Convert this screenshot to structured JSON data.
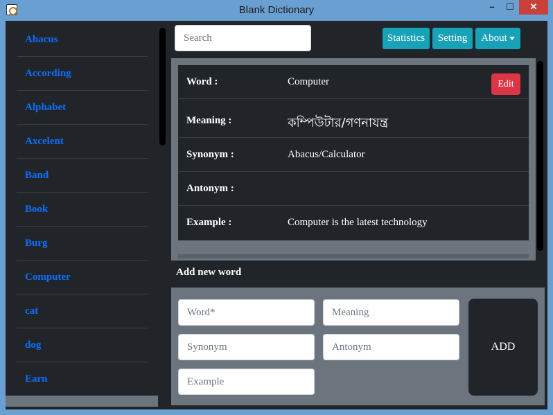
{
  "window": {
    "title": "Blank Dictionary",
    "minimize": "–",
    "maximize": "☐",
    "close": "✕"
  },
  "sidebar": {
    "items": [
      {
        "label": "Abacus"
      },
      {
        "label": "According"
      },
      {
        "label": "Alphabet"
      },
      {
        "label": "Axcelent"
      },
      {
        "label": "Band"
      },
      {
        "label": "Book"
      },
      {
        "label": "Burg"
      },
      {
        "label": "Computer"
      },
      {
        "label": "cat"
      },
      {
        "label": "dog"
      },
      {
        "label": "Earn"
      }
    ]
  },
  "toolbar": {
    "search_placeholder": "Search",
    "statistics_label": "Statistics",
    "setting_label": "Setting",
    "about_label": "About"
  },
  "detail": {
    "edit_label": "Edit",
    "rows": [
      {
        "label": "Word :",
        "value": "Computer"
      },
      {
        "label": "Meaning :",
        "value": "কম্পিউটার/গণনাযন্ত্র"
      },
      {
        "label": "Synonym :",
        "value": "Abacus/Calculator"
      },
      {
        "label": "Antonym :",
        "value": ""
      },
      {
        "label": "Example :",
        "value": "Computer is the latest technology"
      }
    ]
  },
  "add_form": {
    "title": "Add new word",
    "word_placeholder": "Word*",
    "meaning_placeholder": "Meaning",
    "synonym_placeholder": "Synonym",
    "antonym_placeholder": "Antonym",
    "example_placeholder": "Example",
    "add_label": "ADD"
  },
  "colors": {
    "titlebar": "#6a9fd1",
    "dark_bg": "#212529",
    "panel_gray": "#6c757d",
    "link_blue": "#0d6efd",
    "info": "#17a2b8",
    "danger": "#dc3545",
    "close_red": "#c8403a"
  }
}
